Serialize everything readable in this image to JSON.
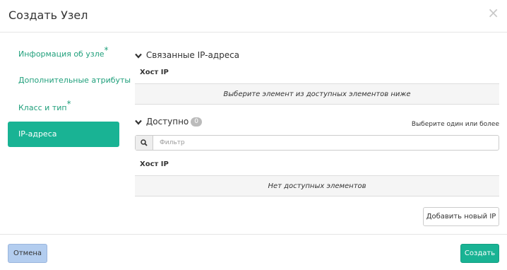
{
  "modal": {
    "title": "Создать Узел",
    "close_glyph": "×"
  },
  "nav": {
    "items": [
      {
        "label": "Информация об узле",
        "required": "*"
      },
      {
        "label": "Дополнительные атрибуты",
        "required": ""
      },
      {
        "label": "Класс и тип",
        "required": "*"
      },
      {
        "label": "IP-адреса",
        "required": ""
      }
    ],
    "active_index": 3
  },
  "allocated": {
    "title": "Связанные IP-адреса",
    "column": "Хост IP",
    "empty_text": "Выберите элемент из доступных элементов ниже"
  },
  "available": {
    "title": "Доступно",
    "count": "0",
    "hint": "Выберите один или более",
    "filter_placeholder": "Фильтр",
    "column": "Хост IP",
    "empty_text": "Нет доступных элементов"
  },
  "buttons": {
    "add_ip": "Добавить новый IP",
    "cancel": "Отмена",
    "create": "Создать"
  },
  "colors": {
    "accent": "#19b394",
    "nav_text": "#21a07c",
    "cancel_bg": "#b3cdef"
  }
}
